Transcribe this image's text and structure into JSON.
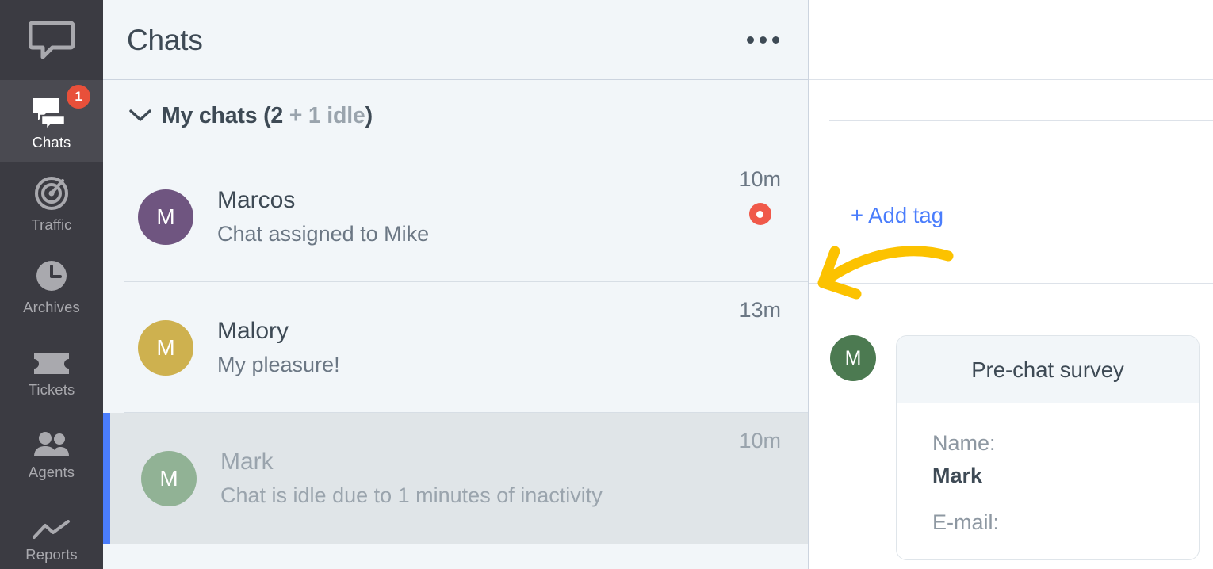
{
  "sidebar": {
    "logo_icon": "livechat-speech-bubble-logo",
    "items": [
      {
        "label": "Chats",
        "icon": "chats-icon",
        "badge": "1",
        "active": true
      },
      {
        "label": "Traffic",
        "icon": "traffic-icon",
        "badge": "",
        "active": false
      },
      {
        "label": "Archives",
        "icon": "archives-clock-icon",
        "badge": "",
        "active": false
      },
      {
        "label": "Tickets",
        "icon": "tickets-icon",
        "badge": "",
        "active": false
      },
      {
        "label": "Agents",
        "icon": "agents-people-icon",
        "badge": "",
        "active": false
      },
      {
        "label": "Reports",
        "icon": "reports-chart-icon",
        "badge": "",
        "active": false
      }
    ]
  },
  "chat_list": {
    "header": {
      "title": "Chats",
      "more_icon": "ellipsis-icon"
    },
    "group": {
      "chevron_icon": "chevron-down-icon",
      "label_main": "My chats (2",
      "label_muted": " + 1 idle",
      "label_tail": ")"
    },
    "rows": [
      {
        "avatar_initial": "M",
        "avatar_color": "#6f5580",
        "name": "Marcos",
        "message": "Chat assigned to Mike",
        "time": "10m",
        "unread": true,
        "idle": false,
        "selected": false
      },
      {
        "avatar_initial": "M",
        "avatar_color": "#ceb14f",
        "name": "Malory",
        "message": "My pleasure!",
        "time": "13m",
        "unread": false,
        "idle": false,
        "selected": false
      },
      {
        "avatar_initial": "M",
        "avatar_color": "#91b295",
        "name": "Mark",
        "message": "Chat is idle due to 1 minutes of inactivity",
        "time": "10m",
        "unread": false,
        "idle": true,
        "selected": true
      }
    ]
  },
  "detail": {
    "add_tag_label": "+ Add tag",
    "annotation_icon": "yellow-curved-arrow",
    "annotation_color": "#fcc200",
    "message": {
      "avatar_initial": "M",
      "avatar_color": "#4c7a51",
      "card_title": "Pre-chat survey",
      "fields": [
        {
          "label": "Name:",
          "value": "Mark"
        },
        {
          "label": "E-mail:",
          "value": ""
        }
      ]
    }
  },
  "colors": {
    "rail_bg": "#3b3b42",
    "rail_active_bg": "#4a4a51",
    "list_bg": "#f2f6f9",
    "selected_row_bg": "#e0e5e8",
    "selected_marker": "#4a7dfc",
    "accent_blue": "#4a7dfc",
    "badge_red": "#e8503a",
    "unread_red": "#f0594a",
    "text_dark": "#3e4a55",
    "text_muted": "#9aa4ad"
  }
}
